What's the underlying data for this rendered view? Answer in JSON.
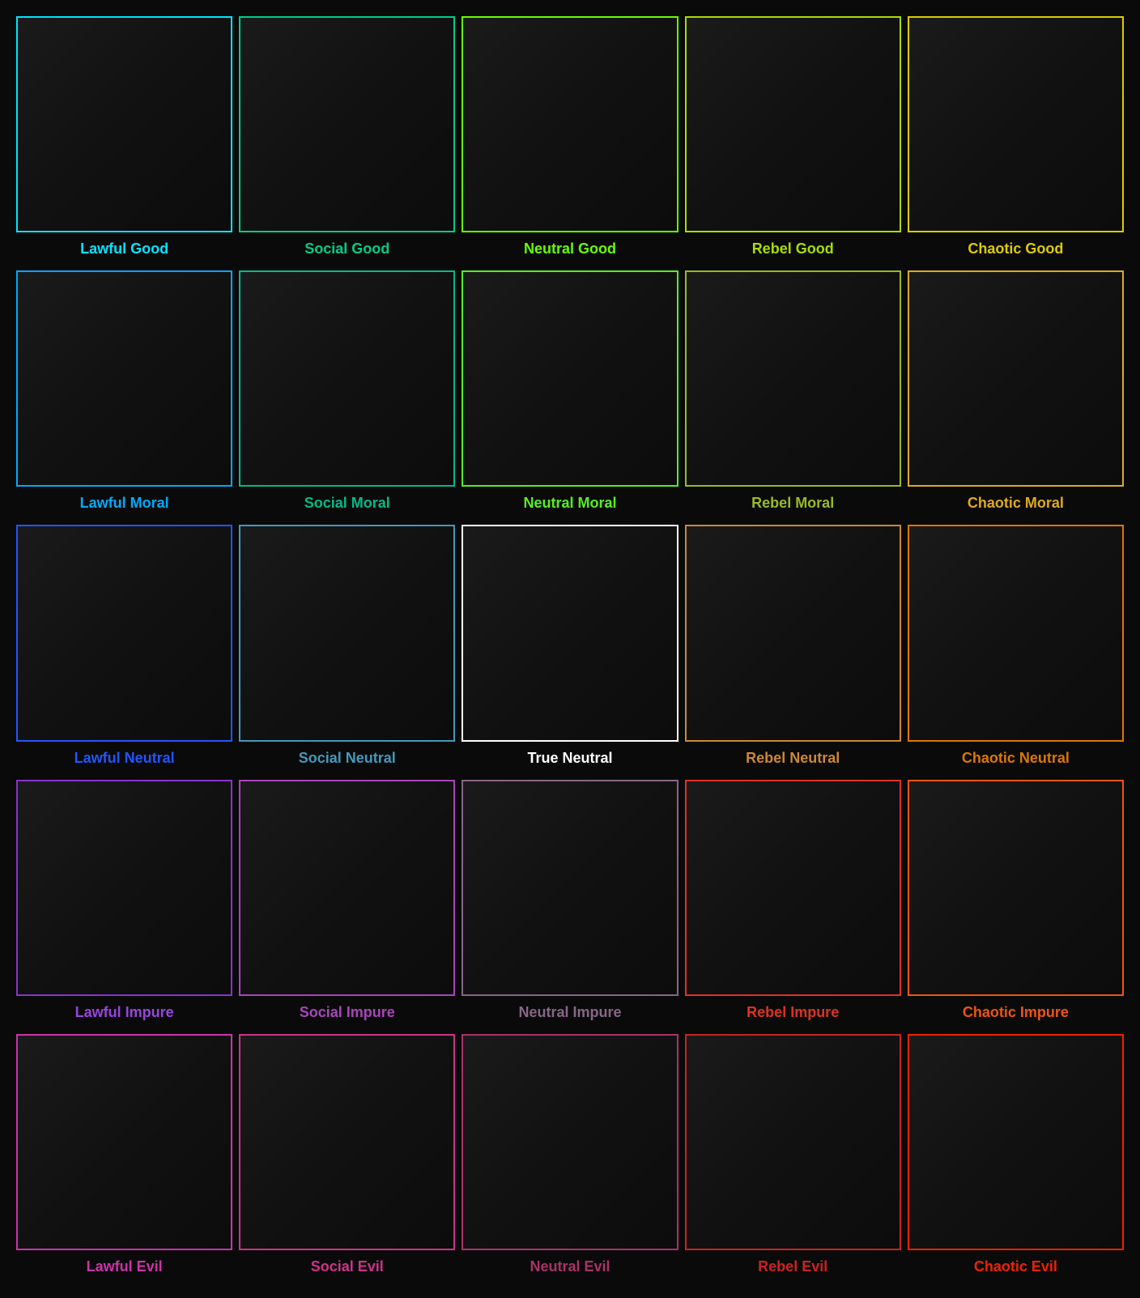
{
  "cells": [
    {
      "label": "Lawful Good",
      "border": "#00e5ff",
      "labelColor": "#00e5ff"
    },
    {
      "label": "Social Good",
      "border": "#00cc88",
      "labelColor": "#00cc88"
    },
    {
      "label": "Neutral Good",
      "border": "#66ff00",
      "labelColor": "#66ff00"
    },
    {
      "label": "Rebel Good",
      "border": "#aadd00",
      "labelColor": "#aadd00"
    },
    {
      "label": "Chaotic Good",
      "border": "#ddcc00",
      "labelColor": "#ddcc00"
    },
    {
      "label": "Lawful Moral",
      "border": "#00aaff",
      "labelColor": "#00aaff"
    },
    {
      "label": "Social Moral",
      "border": "#00bb88",
      "labelColor": "#00bb88"
    },
    {
      "label": "Neutral Moral",
      "border": "#55ee22",
      "labelColor": "#55ee22"
    },
    {
      "label": "Rebel Moral",
      "border": "#99bb22",
      "labelColor": "#99bb22"
    },
    {
      "label": "Chaotic Moral",
      "border": "#ddaa22",
      "labelColor": "#ddaa22"
    },
    {
      "label": "Lawful Neutral",
      "border": "#2255ff",
      "labelColor": "#2255ff"
    },
    {
      "label": "Social Neutral",
      "border": "#4499bb",
      "labelColor": "#4499bb"
    },
    {
      "label": "True Neutral",
      "border": "#ffffff",
      "labelColor": "#ffffff"
    },
    {
      "label": "Rebel Neutral",
      "border": "#cc8833",
      "labelColor": "#cc8833"
    },
    {
      "label": "Chaotic Neutral",
      "border": "#dd7700",
      "labelColor": "#dd7700"
    },
    {
      "label": "Lawful Impure",
      "border": "#8833cc",
      "labelColor": "#9944dd"
    },
    {
      "label": "Social Impure",
      "border": "#aa44bb",
      "labelColor": "#aa44bb"
    },
    {
      "label": "Neutral Impure",
      "border": "#886688",
      "labelColor": "#886688"
    },
    {
      "label": "Rebel Impure",
      "border": "#dd3322",
      "labelColor": "#dd3322"
    },
    {
      "label": "Chaotic Impure",
      "border": "#ee5511",
      "labelColor": "#ee5511"
    },
    {
      "label": "Lawful Evil",
      "border": "#cc33aa",
      "labelColor": "#cc33aa"
    },
    {
      "label": "Social Evil",
      "border": "#cc3388",
      "labelColor": "#cc3388"
    },
    {
      "label": "Neutral Evil",
      "border": "#aa3366",
      "labelColor": "#aa3366"
    },
    {
      "label": "Rebel Evil",
      "border": "#cc2222",
      "labelColor": "#cc2222"
    },
    {
      "label": "Chaotic Evil",
      "border": "#ee2200",
      "labelColor": "#ee2200"
    }
  ]
}
